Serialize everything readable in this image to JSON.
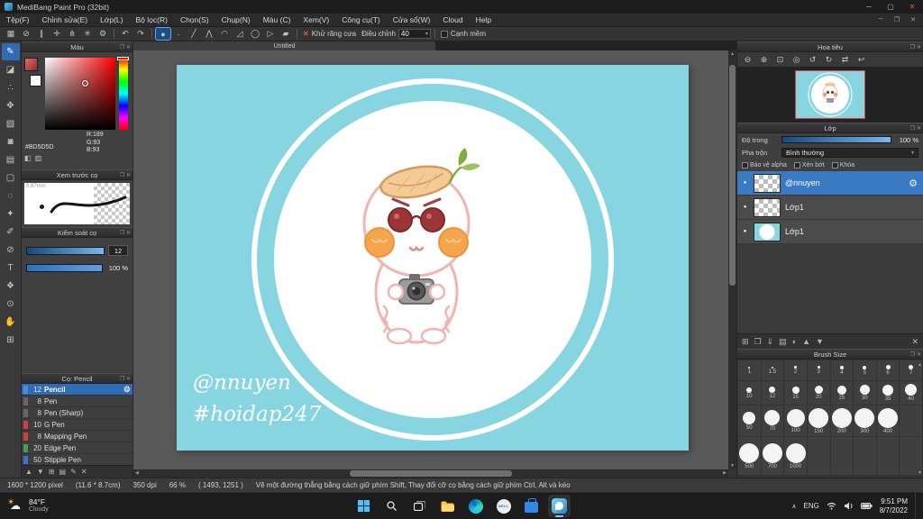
{
  "ui": {
    "detach_glyph": "❐",
    "close_glyph": "✕",
    "caret_down": "▾",
    "eye": "●",
    "scroll_up": "▴",
    "scroll_down": "▾",
    "vscroll_up": "▲",
    "vscroll_down": "▼",
    "hscroll_left": "◀",
    "hscroll_right": "▶",
    "tray_arrow": "∧"
  },
  "title_bar": {
    "title": "MediBang Paint Pro (32bit)",
    "minimize_glyph": "─",
    "maximize_glyph": "▢",
    "close_glyph": "✕"
  },
  "menu_bar": {
    "items": [
      {
        "label": "Tệp(F)",
        "name": "menu-file"
      },
      {
        "label": "Chỉnh sửa(E)",
        "name": "menu-edit"
      },
      {
        "label": "Lớp(L)",
        "name": "menu-layer"
      },
      {
        "label": "Bộ lọc(R)",
        "name": "menu-filter"
      },
      {
        "label": "Chọn(S)",
        "name": "menu-select"
      },
      {
        "label": "Chụp(N)",
        "name": "menu-snap"
      },
      {
        "label": "Màu (C)",
        "name": "menu-color"
      },
      {
        "label": "Xem(V)",
        "name": "menu-view"
      },
      {
        "label": "Công cụ(T)",
        "name": "menu-tool"
      },
      {
        "label": "Cửa sổ(W)",
        "name": "menu-window"
      },
      {
        "label": "Cloud",
        "name": "menu-cloud"
      },
      {
        "label": "Help",
        "name": "menu-help"
      }
    ],
    "child_controls": [
      {
        "glyph": "─",
        "name": "child-minimize-button"
      },
      {
        "glyph": "❐",
        "name": "child-restore-button"
      },
      {
        "glyph": "✕",
        "name": "child-close-button"
      }
    ]
  },
  "toolbar": {
    "file_icons": [
      {
        "name": "toolbar-transform-icon",
        "glyph": "▦"
      },
      {
        "name": "toolbar-snap-off-icon",
        "glyph": "⊘"
      },
      {
        "name": "toolbar-snap-parallel-icon",
        "glyph": "∥"
      },
      {
        "name": "toolbar-snap-cross-icon",
        "glyph": "✛"
      },
      {
        "name": "toolbar-snap-vanishing-icon",
        "glyph": "⋔"
      },
      {
        "name": "toolbar-snap-radial-icon",
        "glyph": "✳"
      },
      {
        "name": "toolbar-snap-settings-icon",
        "glyph": "⚙"
      }
    ],
    "history_icons": [
      {
        "name": "undo-icon",
        "glyph": "↶"
      },
      {
        "name": "redo-icon",
        "glyph": "↷"
      }
    ],
    "mode_icons": [
      {
        "name": "mode-freehand-icon",
        "glyph": "●",
        "selected": true
      },
      {
        "name": "mode-dot-icon",
        "glyph": "∙"
      },
      {
        "name": "mode-line-icon",
        "glyph": "╱"
      },
      {
        "name": "mode-polyline-icon",
        "glyph": "⋀"
      },
      {
        "name": "mode-curve-icon",
        "glyph": "◠"
      },
      {
        "name": "mode-figure-icon",
        "glyph": "◿"
      },
      {
        "name": "mode-ellipse-icon",
        "glyph": "◯"
      },
      {
        "name": "mode-polygon-icon",
        "glyph": "▷"
      },
      {
        "name": "mode-fillrect-icon",
        "glyph": "▰"
      }
    ],
    "antialias_x": "✕",
    "antialias_label": "Khử răng cưa",
    "correction_label": "Điều chỉnh",
    "correction_value": "40",
    "soft_edge_label": "Cạnh mềm"
  },
  "tool_strip": {
    "tools": [
      {
        "name": "brush-tool",
        "glyph": "✎",
        "selected": true
      },
      {
        "name": "eraser-tool",
        "glyph": "◪"
      },
      {
        "name": "dot-tool",
        "glyph": "∴"
      },
      {
        "name": "move-tool",
        "glyph": "✥"
      },
      {
        "name": "fill-tool",
        "glyph": "▧"
      },
      {
        "name": "bucket-tool",
        "glyph": "◙"
      },
      {
        "name": "gradient-tool",
        "glyph": "▤"
      },
      {
        "name": "select-tool",
        "glyph": "▢"
      },
      {
        "name": "lasso-tool",
        "glyph": "◌"
      },
      {
        "name": "magic-wand-tool",
        "glyph": "✦"
      },
      {
        "name": "select-pen-tool",
        "glyph": "✐"
      },
      {
        "name": "select-eraser-tool",
        "glyph": "⊘"
      },
      {
        "name": "text-tool",
        "glyph": "T"
      },
      {
        "name": "shape-brush-tool",
        "glyph": "❖"
      },
      {
        "name": "eyedropper-tool",
        "glyph": "⊙"
      },
      {
        "name": "hand-tool",
        "glyph": "✋"
      },
      {
        "name": "divide-tool",
        "glyph": "⊞"
      }
    ]
  },
  "color_panel": {
    "title": "Màu",
    "r": "R:189",
    "g": "G:93",
    "b": "B:93",
    "hex": "#BD5D5D",
    "fg_color": "#BD5D5D",
    "mini_icons": [
      {
        "name": "color-grid-icon",
        "glyph": "◧"
      },
      {
        "name": "color-slider-icon",
        "glyph": "▥"
      }
    ]
  },
  "brush_preview_panel": {
    "title": "Xem trước cọ",
    "size_label": "0.87mm"
  },
  "brush_control_panel": {
    "title": "Kiểm soát cọ",
    "size_value": "12",
    "opacity_value": "100 %"
  },
  "brush_list_panel": {
    "title": "Cọ: Pencil",
    "gear_glyph": "⚙",
    "brushes": [
      {
        "id": "brush-pencil",
        "size": "12",
        "name": "Pencil",
        "color": "#4a90d9",
        "selected": true
      },
      {
        "id": "brush-pen",
        "size": "8",
        "name": "Pen",
        "color": "#666666"
      },
      {
        "id": "brush-pen-sharp",
        "size": "8",
        "name": "Pen (Sharp)",
        "color": "#666666"
      },
      {
        "id": "brush-g-pen",
        "size": "10",
        "name": "G Pen",
        "color": "#d04038"
      },
      {
        "id": "brush-mapping-pen",
        "size": "8",
        "name": "Mapping Pen",
        "color": "#d04038"
      },
      {
        "id": "brush-edge-pen",
        "size": "20",
        "name": "Edge Pen",
        "color": "#3fa34d"
      },
      {
        "id": "brush-stipple-pen",
        "size": "50",
        "name": "Stipple Pen",
        "color": "#3f6fd0"
      }
    ],
    "footer_icons": [
      {
        "name": "brush-up-icon",
        "glyph": "▲"
      },
      {
        "name": "brush-down-icon",
        "glyph": "▼"
      },
      {
        "name": "add-brush-icon",
        "glyph": "⊞"
      },
      {
        "name": "brush-folder-icon",
        "glyph": "▤"
      },
      {
        "name": "edit-brush-icon",
        "glyph": "✎"
      },
      {
        "name": "delete-brush-icon",
        "glyph": "✕"
      }
    ]
  },
  "canvas": {
    "tab_title": "Untitled",
    "watermark_line1": "@nnuyen",
    "watermark_line2": "#hoidap247",
    "bg_color": "#86d5e0"
  },
  "navigator_panel": {
    "title": "Hoa tiêu",
    "icons": [
      {
        "name": "zoom-out-icon",
        "glyph": "⊖"
      },
      {
        "name": "zoom-in-icon",
        "glyph": "⊕"
      },
      {
        "name": "zoom-fit-icon",
        "glyph": "⊡"
      },
      {
        "name": "zoom-original-icon",
        "glyph": "◎"
      },
      {
        "name": "rotate-left-icon",
        "glyph": "↺"
      },
      {
        "name": "rotate-right-icon",
        "glyph": "↻"
      },
      {
        "name": "flip-horizontal-icon",
        "glyph": "⇄"
      },
      {
        "name": "reset-view-icon",
        "glyph": "↩"
      }
    ]
  },
  "layer_panel": {
    "title": "Lớp",
    "opacity_label": "Độ trong",
    "opacity_value": "100 %",
    "blend_label": "Pha trộn",
    "blend_value": "Bình thường",
    "checkboxes": [
      "Bảo vệ alpha",
      "Xén bớt",
      "Khóa"
    ],
    "eye_glyph": "●",
    "gear_glyph": "⚙",
    "layers": [
      {
        "name": "@nnuyen",
        "selected": true,
        "thumb": "checker"
      },
      {
        "name": "Lớp1",
        "thumb": "checker"
      },
      {
        "name": "Lớp1",
        "thumb": "art"
      }
    ],
    "footer_icons": [
      {
        "name": "add-layer-icon",
        "glyph": "⊞"
      },
      {
        "name": "duplicate-layer-icon",
        "glyph": "❐"
      },
      {
        "name": "merge-layer-icon",
        "glyph": "⇓"
      },
      {
        "name": "layer-folder-icon",
        "glyph": "▤"
      },
      {
        "name": "layer-mask-icon",
        "glyph": "◐"
      },
      {
        "name": "layer-up-icon",
        "glyph": "▲"
      },
      {
        "name": "layer-down-icon",
        "glyph": "▼"
      },
      {
        "name": "delete-layer-icon",
        "glyph": "✕"
      }
    ]
  },
  "brush_size_panel": {
    "title": "Brush Size",
    "rows": [
      [
        "1",
        "1.5",
        "2",
        "3",
        "4",
        "5",
        "6",
        "7"
      ],
      [
        "10",
        "12",
        "15",
        "20",
        "25",
        "30",
        "35",
        "40"
      ],
      [
        "50",
        "70",
        "100",
        "150",
        "200",
        "300",
        "400",
        ""
      ],
      [
        "500",
        "700",
        "1000",
        "",
        "",
        "",
        "",
        ""
      ]
    ]
  },
  "status_bar": {
    "segments": [
      "1600 * 1200 pixel",
      "(11.6 * 8.7cm)",
      "350 dpi",
      "66 %",
      "( 1493, 1251 )",
      "Vẽ một đường thẳng bằng cách giữ phím Shift, Thay đổi cỡ cọ bằng cách giữ phím Ctrl, Alt và kéo"
    ]
  },
  "taskbar": {
    "weather_temp": "84°F",
    "weather_desc": "Cloudy",
    "dell_label": "DELL",
    "language": "ENG",
    "time": "9:51 PM",
    "date": "8/7/2022"
  }
}
